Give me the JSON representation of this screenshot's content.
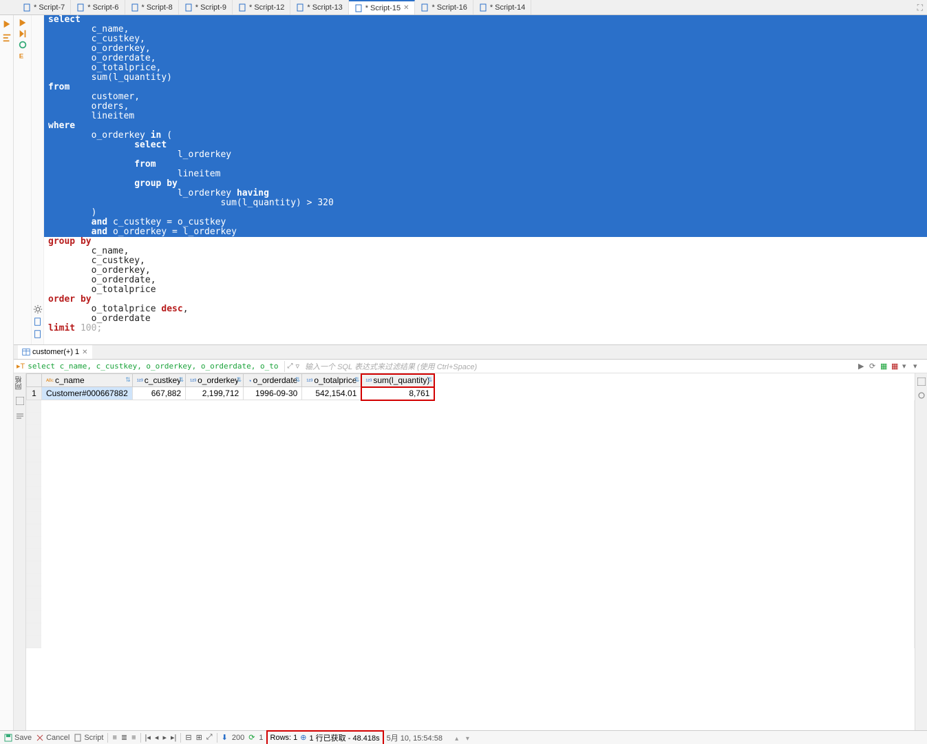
{
  "tabs": [
    {
      "label": "*<atom> Script-7",
      "active": false
    },
    {
      "label": "*<atom> Script-6",
      "active": false
    },
    {
      "label": "*<atom> Script-8",
      "active": false
    },
    {
      "label": "*<atom> Script-9",
      "active": false
    },
    {
      "label": "*<atom> Script-12",
      "active": false
    },
    {
      "label": "*<mysql> Script-13",
      "active": false
    },
    {
      "label": "*<atom> Script-15",
      "active": true
    },
    {
      "label": "*<atom> Script-16",
      "active": false
    },
    {
      "label": "*<atom> Script-14",
      "active": false
    }
  ],
  "sql": [
    {
      "t": "select",
      "sel": true,
      "kw": true,
      "indent": 0
    },
    {
      "t": "c_name,",
      "sel": true,
      "indent": 2
    },
    {
      "t": "c_custkey,",
      "sel": true,
      "indent": 2
    },
    {
      "t": "o_orderkey,",
      "sel": true,
      "indent": 2
    },
    {
      "t": "o_orderdate,",
      "sel": true,
      "indent": 2
    },
    {
      "t": "o_totalprice,",
      "sel": true,
      "indent": 2
    },
    {
      "t": "sum(l_quantity)",
      "sel": true,
      "indent": 2
    },
    {
      "t": "from",
      "sel": true,
      "kw": true,
      "indent": 0
    },
    {
      "t": "customer,",
      "sel": true,
      "indent": 2
    },
    {
      "t": "orders,",
      "sel": true,
      "indent": 2
    },
    {
      "t": "lineitem",
      "sel": true,
      "indent": 2
    },
    {
      "t": "where",
      "sel": true,
      "kw": true,
      "indent": 0
    },
    {
      "t": "o_orderkey in (",
      "sel": true,
      "indent": 2,
      "mixed": [
        {
          "s": "o_orderkey "
        },
        {
          "s": "in",
          "kw": true
        },
        {
          "s": " ("
        }
      ]
    },
    {
      "t": "select",
      "sel": true,
      "kw": true,
      "indent": 4
    },
    {
      "t": "l_orderkey",
      "sel": true,
      "indent": 6
    },
    {
      "t": "from",
      "sel": true,
      "kw": true,
      "indent": 4
    },
    {
      "t": "lineitem",
      "sel": true,
      "indent": 6
    },
    {
      "t": "group by",
      "sel": true,
      "kw": true,
      "indent": 4
    },
    {
      "t": "l_orderkey having",
      "sel": true,
      "indent": 6,
      "mixed": [
        {
          "s": "l_orderkey "
        },
        {
          "s": "having",
          "kw": true
        }
      ]
    },
    {
      "t": "sum(l_quantity) > 320",
      "sel": true,
      "indent": 8
    },
    {
      "t": ")",
      "sel": true,
      "indent": 2
    },
    {
      "t": "and c_custkey = o_custkey",
      "sel": true,
      "indent": 2,
      "mixed": [
        {
          "s": "and ",
          "kw": true
        },
        {
          "s": "c_custkey = o_custkey"
        }
      ]
    },
    {
      "t": "and o_orderkey = l_orderkey",
      "sel": true,
      "indent": 2,
      "mixed": [
        {
          "s": "and ",
          "kw": true
        },
        {
          "s": "o_orderkey = l_orderkey"
        }
      ]
    },
    {
      "t": "group by",
      "kw": true,
      "indent": 0
    },
    {
      "t": "c_name,",
      "indent": 2
    },
    {
      "t": "c_custkey,",
      "indent": 2
    },
    {
      "t": "o_orderkey,",
      "indent": 2
    },
    {
      "t": "o_orderdate,",
      "indent": 2
    },
    {
      "t": "o_totalprice",
      "indent": 2
    },
    {
      "t": "order by",
      "kw": true,
      "indent": 0
    },
    {
      "t": "o_totalprice desc,",
      "indent": 2,
      "mixed": [
        {
          "s": "o_totalprice "
        },
        {
          "s": "desc",
          "kw": true
        },
        {
          "s": ","
        }
      ]
    },
    {
      "t": "o_orderdate",
      "indent": 2
    },
    {
      "t": "limit 100;",
      "indent": 0,
      "mixed": [
        {
          "s": "limit ",
          "kw": true
        },
        {
          "s": "100;"
        }
      ],
      "faded": true
    }
  ],
  "results_tab": {
    "label": "customer(+) 1"
  },
  "filter": {
    "sql_text": "select c_name, c_custkey, o_orderkey, o_orderdate, o_to",
    "placeholder": "输入一个 SQL 表达式来过滤结果 (使用 Ctrl+Space)"
  },
  "grid": {
    "columns": [
      "c_name",
      "c_custkey",
      "o_orderkey",
      "o_orderdate",
      "o_totalprice",
      "sum(l_quantity)"
    ],
    "col_types": [
      "abc",
      "123",
      "123",
      "date",
      "123",
      "123"
    ],
    "rows": [
      {
        "n": "1",
        "c_name": "Customer#000667882",
        "c_custkey": "667,882",
        "o_orderkey": "2,199,712",
        "o_orderdate": "1996-09-30",
        "o_totalprice": "542,154.01",
        "sum": "8,761"
      }
    ]
  },
  "status": {
    "save": "Save",
    "cancel": "Cancel",
    "script": "Script",
    "fetch_size": "200",
    "refresh_n": "1",
    "rows_label": "Rows: 1",
    "fetched": "1 行已获取 - 48.418s",
    "timestamp": "5月 10, 15:54:58"
  }
}
